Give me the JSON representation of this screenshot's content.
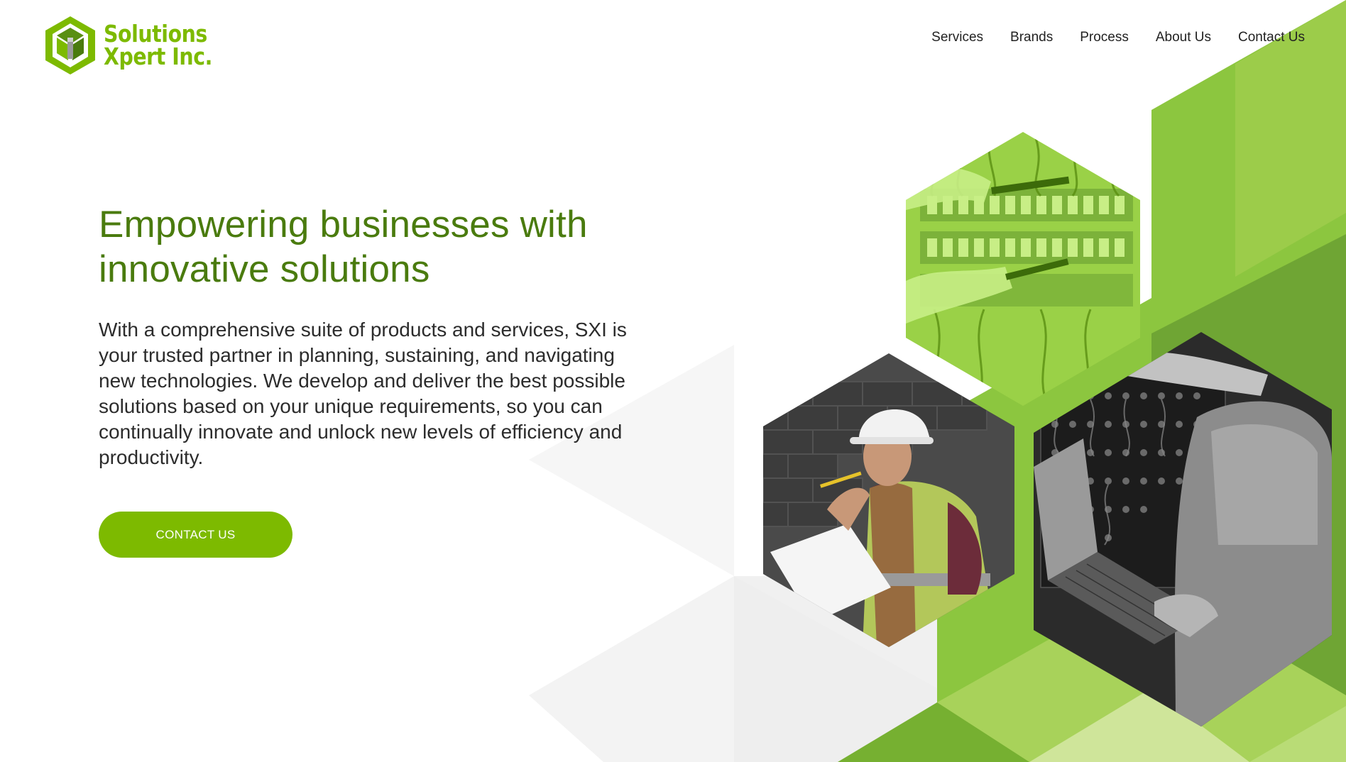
{
  "brand": {
    "name_line1": "Solutions",
    "name_line2": "Xpert Inc.",
    "logo_icon": "hexagon-cube-logo-icon",
    "color_primary": "#7dba00",
    "color_dark": "#4a7b0e"
  },
  "nav": {
    "items": [
      {
        "label": "Services"
      },
      {
        "label": "Brands"
      },
      {
        "label": "Process"
      },
      {
        "label": "About Us"
      },
      {
        "label": "Contact Us"
      }
    ]
  },
  "hero": {
    "title_lines": [
      "Empowering businesses with",
      "innovative solutions"
    ],
    "description_lines": [
      "With a comprehensive suite of products and services, SXI is",
      "your trusted partner in planning, sustaining, and navigating",
      "new technologies. We develop and deliver the best possible",
      "solutions based on your unique requirements, so you can",
      "continually innovate and unlock new levels of efficiency and",
      "productivity."
    ],
    "cta_label": "CONTACT US"
  },
  "images": {
    "hex_top": "green-tinted-network-cabling-photo",
    "hex_left": "engineer-with-hardhat-photo",
    "hex_right": "technician-server-rack-laptop-photo"
  }
}
